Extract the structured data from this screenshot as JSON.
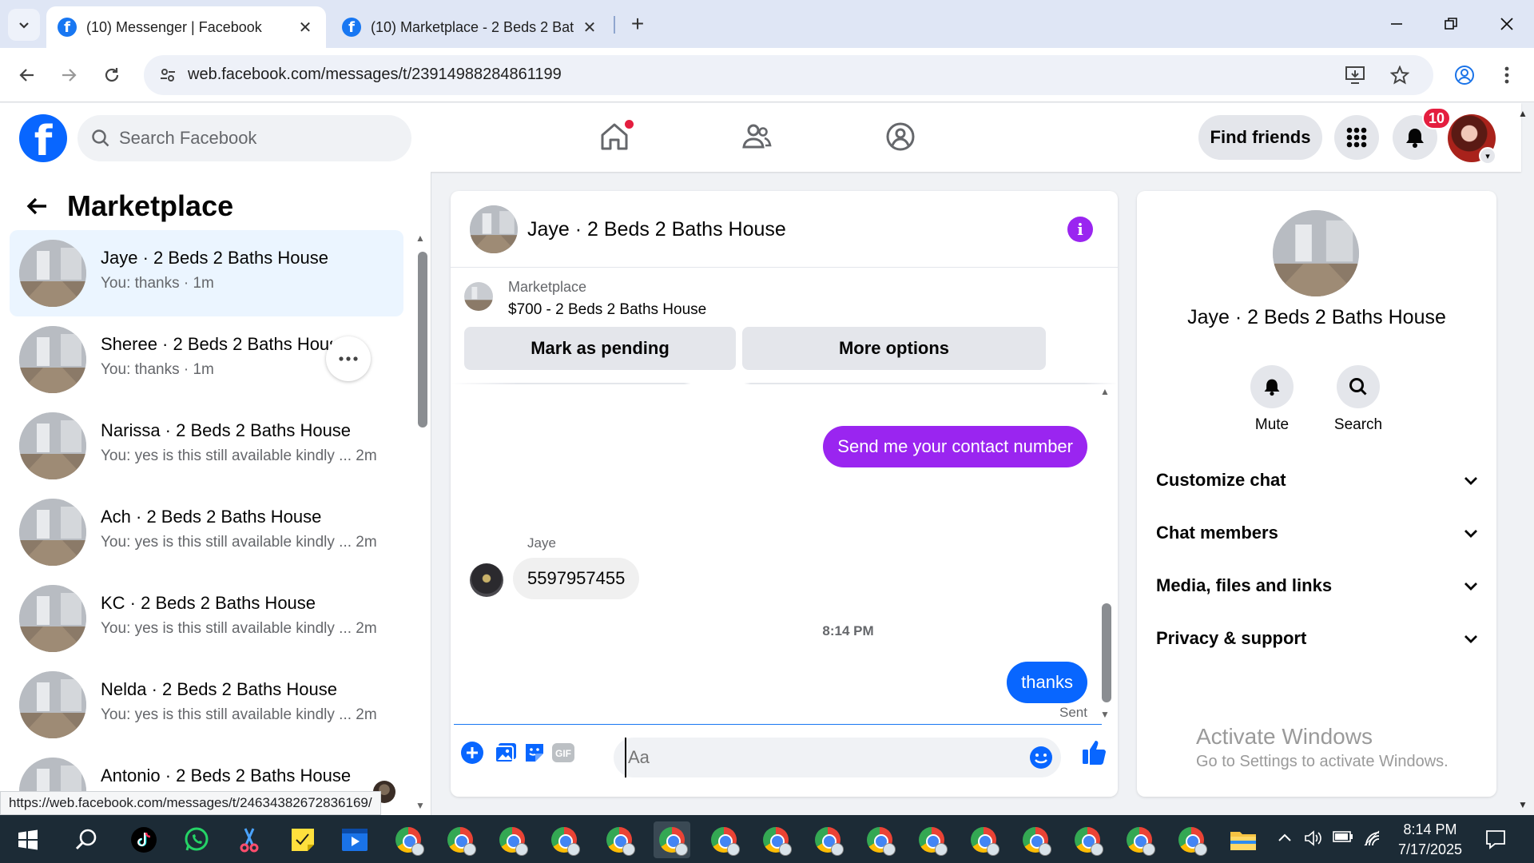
{
  "browser": {
    "tabs": [
      {
        "title": "(10) Messenger | Facebook",
        "active": true
      },
      {
        "title": "(10) Marketplace - 2 Beds 2 Bat",
        "active": false
      }
    ],
    "url": "web.facebook.com/messages/t/23914988284861199",
    "status_url": "https://web.facebook.com/messages/t/24634382672836169/"
  },
  "fb_header": {
    "search_placeholder": "Search Facebook",
    "find_friends_label": "Find friends",
    "notification_count": "10"
  },
  "left_panel": {
    "title": "Marketplace",
    "conversations": [
      {
        "name": "Jaye · 2 Beds 2 Baths House",
        "snippet": "You: thanks · 1m",
        "selected": true
      },
      {
        "name": "Sheree · 2 Beds 2 Baths House",
        "snippet": "You: thanks · 1m",
        "selected": false
      },
      {
        "name": "Narissa · 2 Beds 2 Baths House",
        "snippet": "You: yes is this still available kindly ... 2m",
        "selected": false
      },
      {
        "name": "Ach · 2 Beds 2 Baths House",
        "snippet": "You: yes is this still available kindly ... 2m",
        "selected": false
      },
      {
        "name": "KC · 2 Beds 2 Baths House",
        "snippet": "You: yes is this still available kindly ... 2m",
        "selected": false
      },
      {
        "name": "Nelda · 2 Beds 2 Baths House",
        "snippet": "You: yes is this still available kindly ... 2m",
        "selected": false
      },
      {
        "name": "Antonio · 2 Beds 2 Baths House",
        "snippet": "",
        "selected": false
      }
    ]
  },
  "chat": {
    "title": "Jaye · 2 Beds 2 Baths House",
    "listing": {
      "label": "Marketplace",
      "price_title": "$700 - 2 Beds 2 Baths House",
      "mark_pending_label": "Mark as pending",
      "more_options_label": "More options"
    },
    "messages": {
      "out_1": "Send me your contact number",
      "in_sender": "Jaye",
      "in_1": "5597957455",
      "time": "8:14 PM",
      "out_2": "thanks",
      "status": "Sent"
    },
    "composer_placeholder": "Aa",
    "colors": {
      "accent_purple": "#9a25f0",
      "accent_blue": "#0866ff"
    }
  },
  "info_panel": {
    "name": "Jaye · 2 Beds 2 Baths House",
    "mute_label": "Mute",
    "search_label": "Search",
    "sections": [
      "Customize chat",
      "Chat members",
      "Media, files and links",
      "Privacy & support"
    ]
  },
  "watermark": {
    "line1": "Activate Windows",
    "line2": "Go to Settings to activate Windows."
  },
  "taskbar": {
    "time": "8:14 PM",
    "date": "7/17/2025"
  }
}
